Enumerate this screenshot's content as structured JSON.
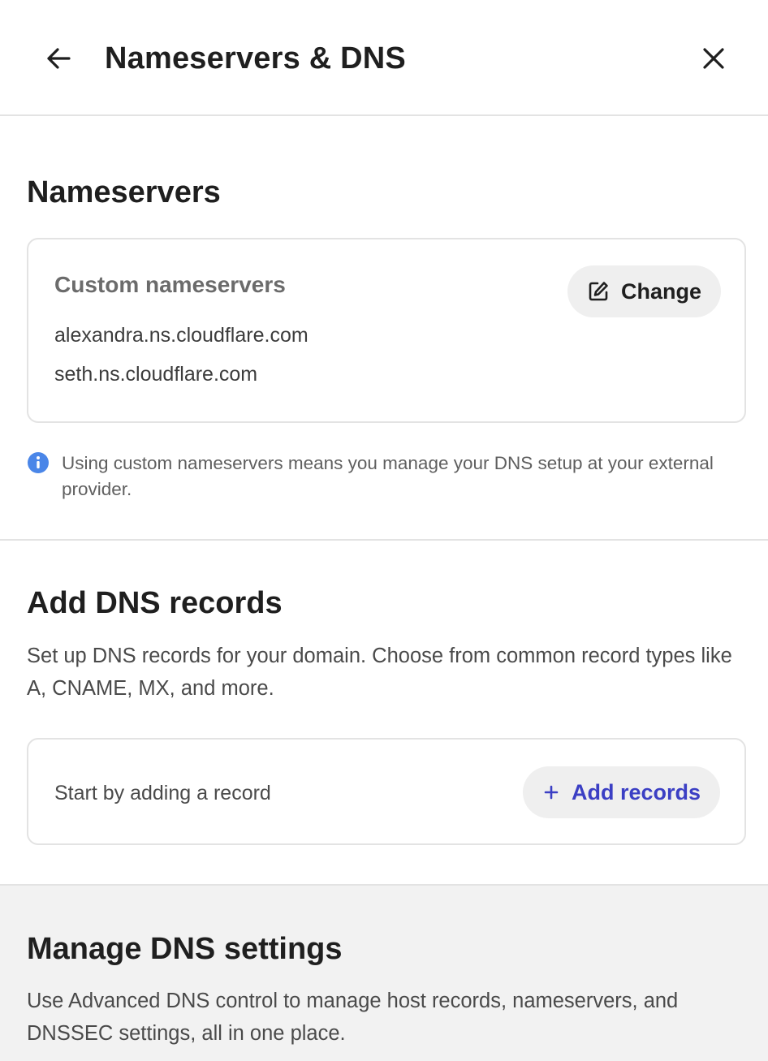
{
  "header": {
    "title": "Nameservers & DNS",
    "back_icon": "arrow-left-icon",
    "close_icon": "close-icon"
  },
  "nameservers": {
    "section_title": "Nameservers",
    "card_heading": "Custom nameservers",
    "servers": [
      "alexandra.ns.cloudflare.com",
      "seth.ns.cloudflare.com"
    ],
    "change_label": "Change",
    "change_icon": "edit-icon",
    "info_icon": "info-icon",
    "info_text": "Using custom nameservers means you manage your DNS setup at your external provider."
  },
  "add_records": {
    "section_title": "Add DNS records",
    "description": "Set up DNS records for your domain. Choose from common record types like A, CNAME, MX, and more.",
    "empty_text": "Start by adding a record",
    "add_label": "Add records",
    "add_icon": "plus-icon"
  },
  "manage": {
    "section_title": "Manage DNS settings",
    "description": "Use Advanced DNS control to manage host records, nameservers, and DNSSEC settings, all in one place."
  },
  "colors": {
    "accent": "#3b3fc4",
    "info_blue": "#4a86e8",
    "text_primary": "#1f1f1f",
    "border": "#e3e3e3",
    "button_bg": "#efefef"
  }
}
